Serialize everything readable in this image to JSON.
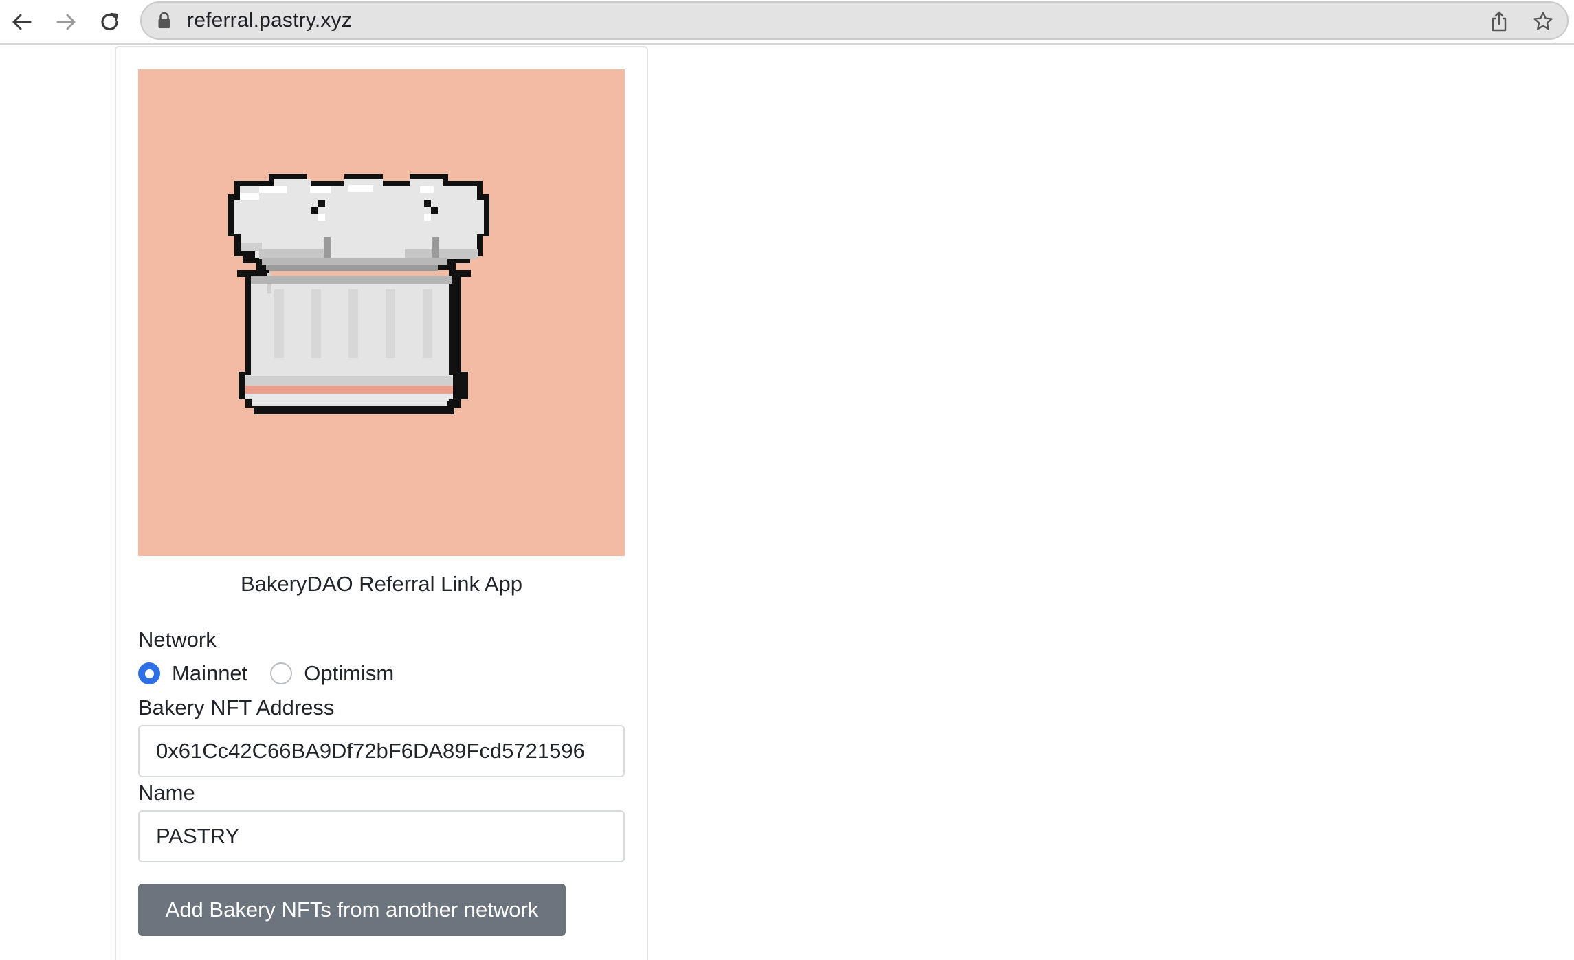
{
  "browser": {
    "url": "referral.pastry.xyz",
    "icons": {
      "back": "arrow-left-icon",
      "forward": "arrow-right-icon",
      "reload": "reload-icon",
      "secure": "lock-icon",
      "share": "share-icon",
      "bookmark": "star-icon"
    }
  },
  "app": {
    "hero_image": "chef-hat-pixel-art",
    "hero_background": "#f3bba3",
    "title": "BakeryDAO Referral Link App"
  },
  "form": {
    "network_label": "Network",
    "network_options": [
      {
        "label": "Mainnet",
        "selected": true
      },
      {
        "label": "Optimism",
        "selected": false
      }
    ],
    "nft_address_label": "Bakery NFT Address",
    "nft_address_value": "0x61Cc42C66BA9Df72bF6DA89Fcd5721596",
    "name_label": "Name",
    "name_value": "PASTRY",
    "add_button_label": "Add Bakery NFTs from another network"
  },
  "colors": {
    "radio_accent": "#2f6fe6",
    "button_background": "#6c757d"
  }
}
